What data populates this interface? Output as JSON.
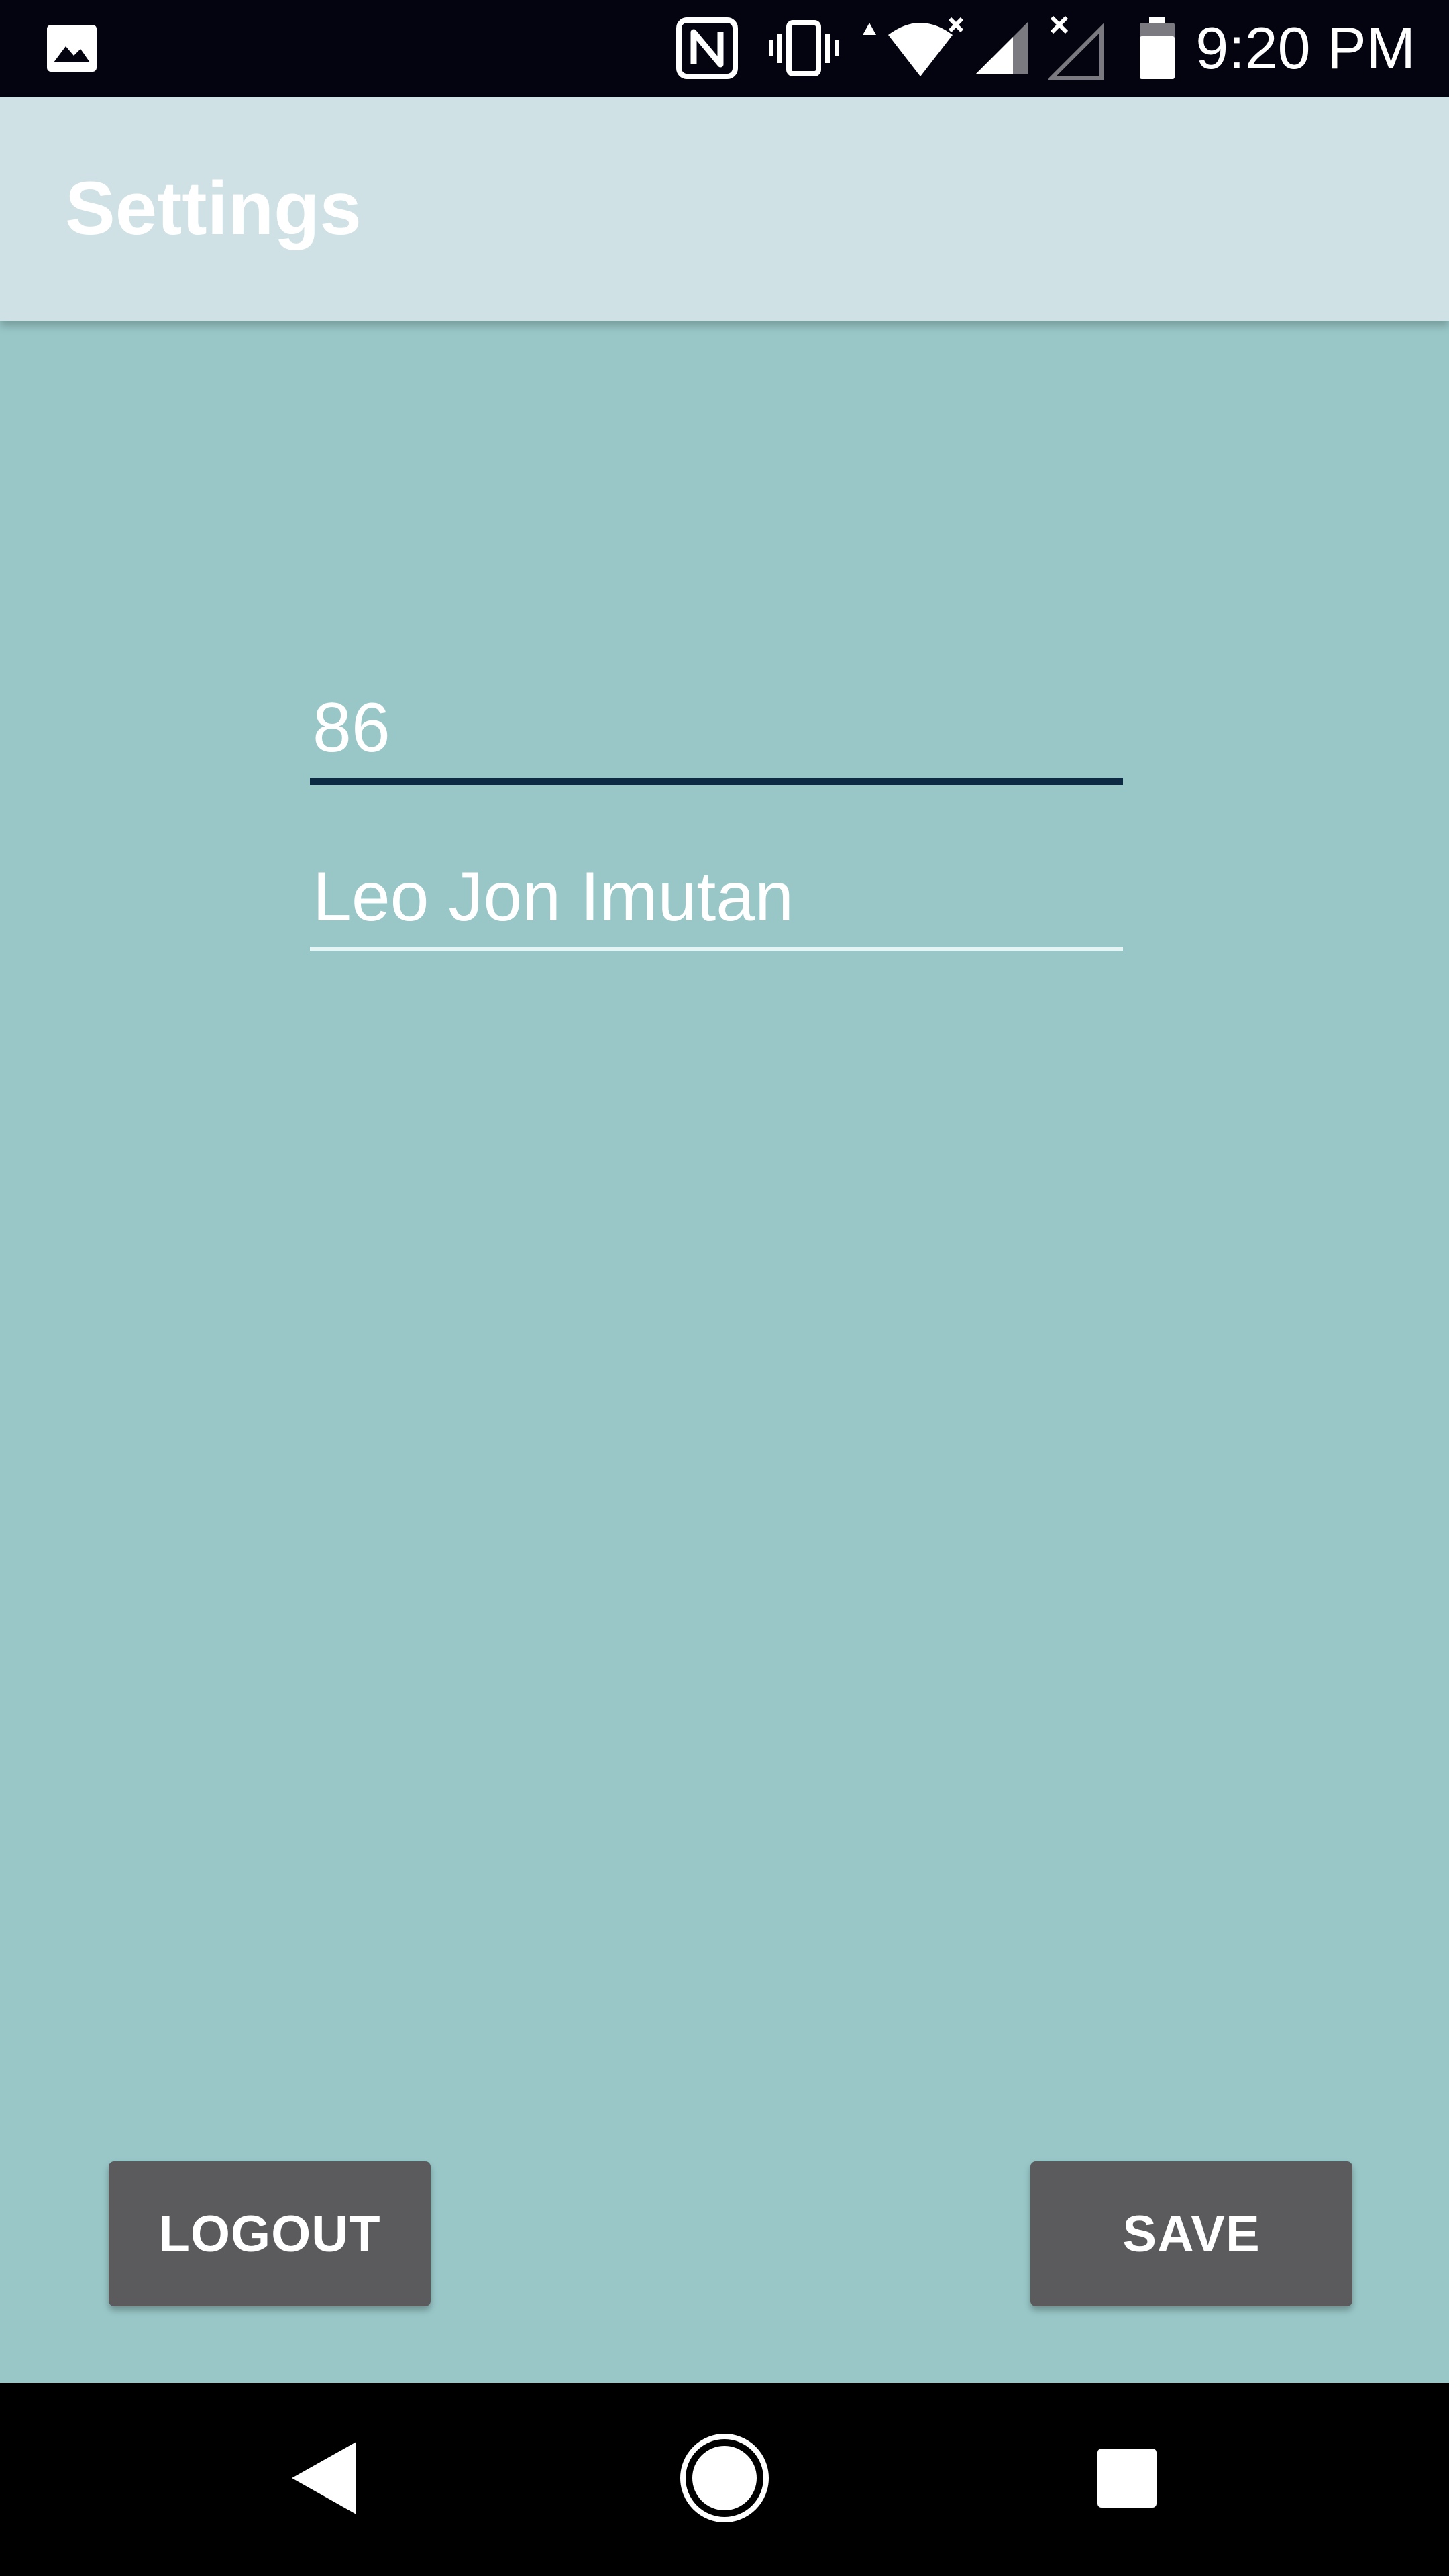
{
  "status_bar": {
    "time": "9:20 PM",
    "icons": [
      "image-notification-icon",
      "nfc-icon",
      "vibrate-icon",
      "wifi-icon",
      "signal-icon",
      "no-signal-icon",
      "battery-icon"
    ]
  },
  "app_bar": {
    "title": "Settings"
  },
  "form": {
    "number_field": {
      "value": "86"
    },
    "name_field": {
      "value": "Leo Jon Imutan"
    }
  },
  "buttons": {
    "logout_label": "LOGOUT",
    "save_label": "SAVE"
  },
  "nav_bar": {
    "icons": [
      "back-icon",
      "home-icon",
      "recents-icon"
    ]
  },
  "colors": {
    "background": "#99c7c8",
    "app_bar": "#cfe1e4",
    "status_bar": "#03040f",
    "button": "#5b5b5d",
    "focused_underline": "#0d2a45"
  }
}
